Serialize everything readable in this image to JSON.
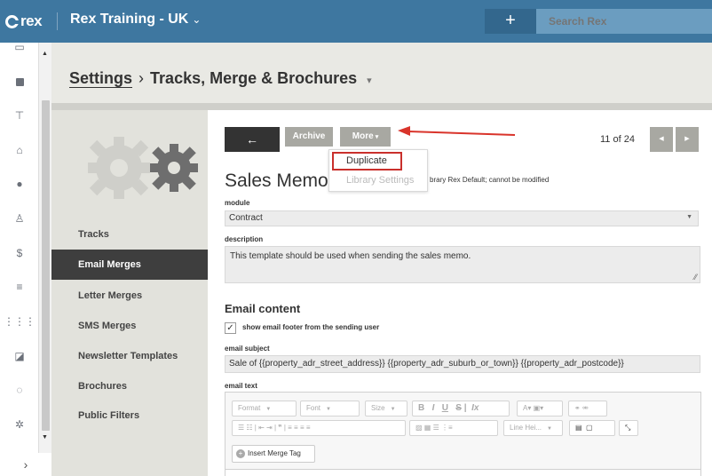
{
  "topbar": {
    "logo": "rex",
    "account": "Rex Training - UK",
    "add_label": "+",
    "search_placeholder": "Search Rex"
  },
  "iconbar": {
    "icons": [
      "calendar-icon",
      "chart-icon",
      "signpost-icon",
      "house-icon",
      "person-icon",
      "contacts-icon",
      "dollar-icon",
      "list-icon",
      "grid-icon",
      "map-icon",
      "refresh-icon",
      "gear-icon"
    ]
  },
  "header": {
    "breadcrumb_root": "Settings",
    "breadcrumb_sep": "›",
    "breadcrumb_current": "Tracks, Merge & Brochures"
  },
  "settings_nav": {
    "items": [
      {
        "label": "Tracks"
      },
      {
        "label": "Email Merges",
        "active": true
      },
      {
        "label": "Letter Merges"
      },
      {
        "label": "SMS Merges"
      },
      {
        "label": "Newsletter Templates"
      },
      {
        "label": "Brochures"
      },
      {
        "label": "Public Filters"
      }
    ]
  },
  "toolbar": {
    "archive_label": "Archive",
    "more_label": "More",
    "pager": "11 of 24"
  },
  "more_menu": {
    "items": [
      "Duplicate",
      "Library Settings"
    ]
  },
  "record": {
    "title": "Sales Memo E",
    "title_note": "brary Rex Default; cannot be modified",
    "module_label": "module",
    "module_value": "Contract",
    "description_label": "description",
    "description_value": "This template should be used when sending the sales memo.",
    "email_content_heading": "Email content",
    "footer_checkbox_label": "show email footer from the sending user",
    "footer_checked": true,
    "subject_label": "email subject",
    "subject_value": "Sale of {{property_adr_street_address}} {{property_adr_suburb_or_town}} {{property_adr_postcode}}",
    "text_label": "email text"
  },
  "editor": {
    "format_label": "Format",
    "font_label": "Font",
    "size_label": "Size",
    "line_height_label": "Line Hei...",
    "bold": "B",
    "italic": "I",
    "underline": "U",
    "strike": "S",
    "merge_tag_label": "Insert Merge Tag"
  },
  "colors": {
    "topbar": "#3e77a0",
    "active_nav": "#3e3e3e",
    "highlight": "#c9302c"
  }
}
